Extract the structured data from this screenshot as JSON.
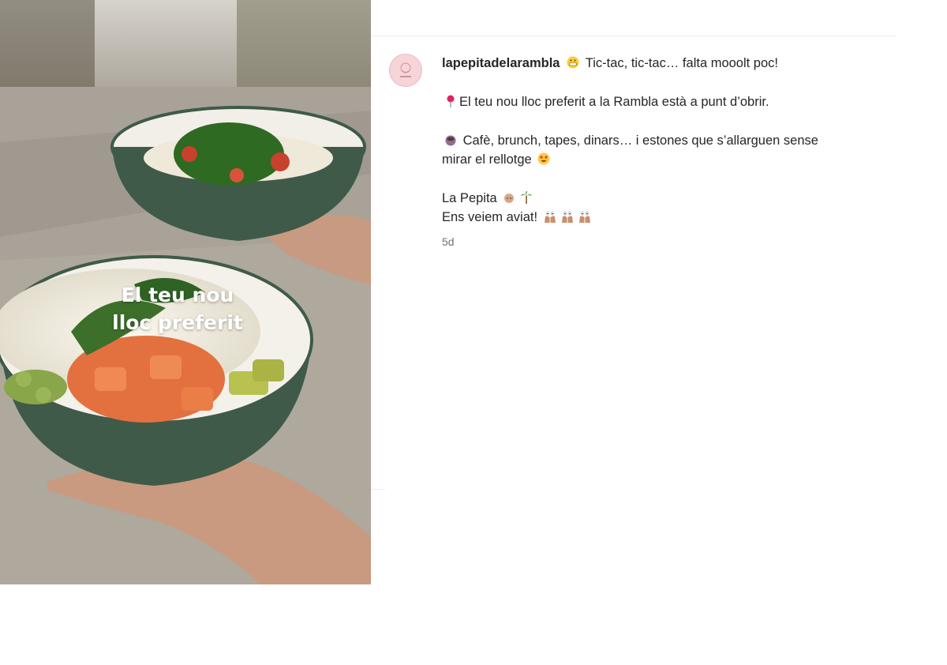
{
  "media": {
    "overlay_line1": "El teu nou",
    "overlay_line2": "lloc preferit"
  },
  "post": {
    "username": "lapepitadelarambla",
    "avatar_icon": "la-pepita-logo-icon",
    "caption": {
      "line1": "Tic-tac, tic-tac… falta mooolt poc!",
      "line2": "El teu nou lloc preferit a la Rambla està a punt d’obrir.",
      "line3a": "Cafè, brunch, tapes, dinars… i estones que s’allarguen sense",
      "line3b": "mirar el rellotge",
      "line4": "La Pepita",
      "line5": "Ens veiem aviat!"
    },
    "emojis": [
      "grimacing-face-icon",
      "round-pushpin-icon",
      "coffee-cup-icon",
      "star-struck-face-icon",
      "old-woman-icon",
      "palm-tree-icon",
      "eyes-hands-icon"
    ],
    "time": "5d"
  },
  "colors": {
    "bowl_green": "#3f5a49",
    "avatar_pink": "#f7d4d8",
    "text": "#262626",
    "muted": "#737373"
  }
}
